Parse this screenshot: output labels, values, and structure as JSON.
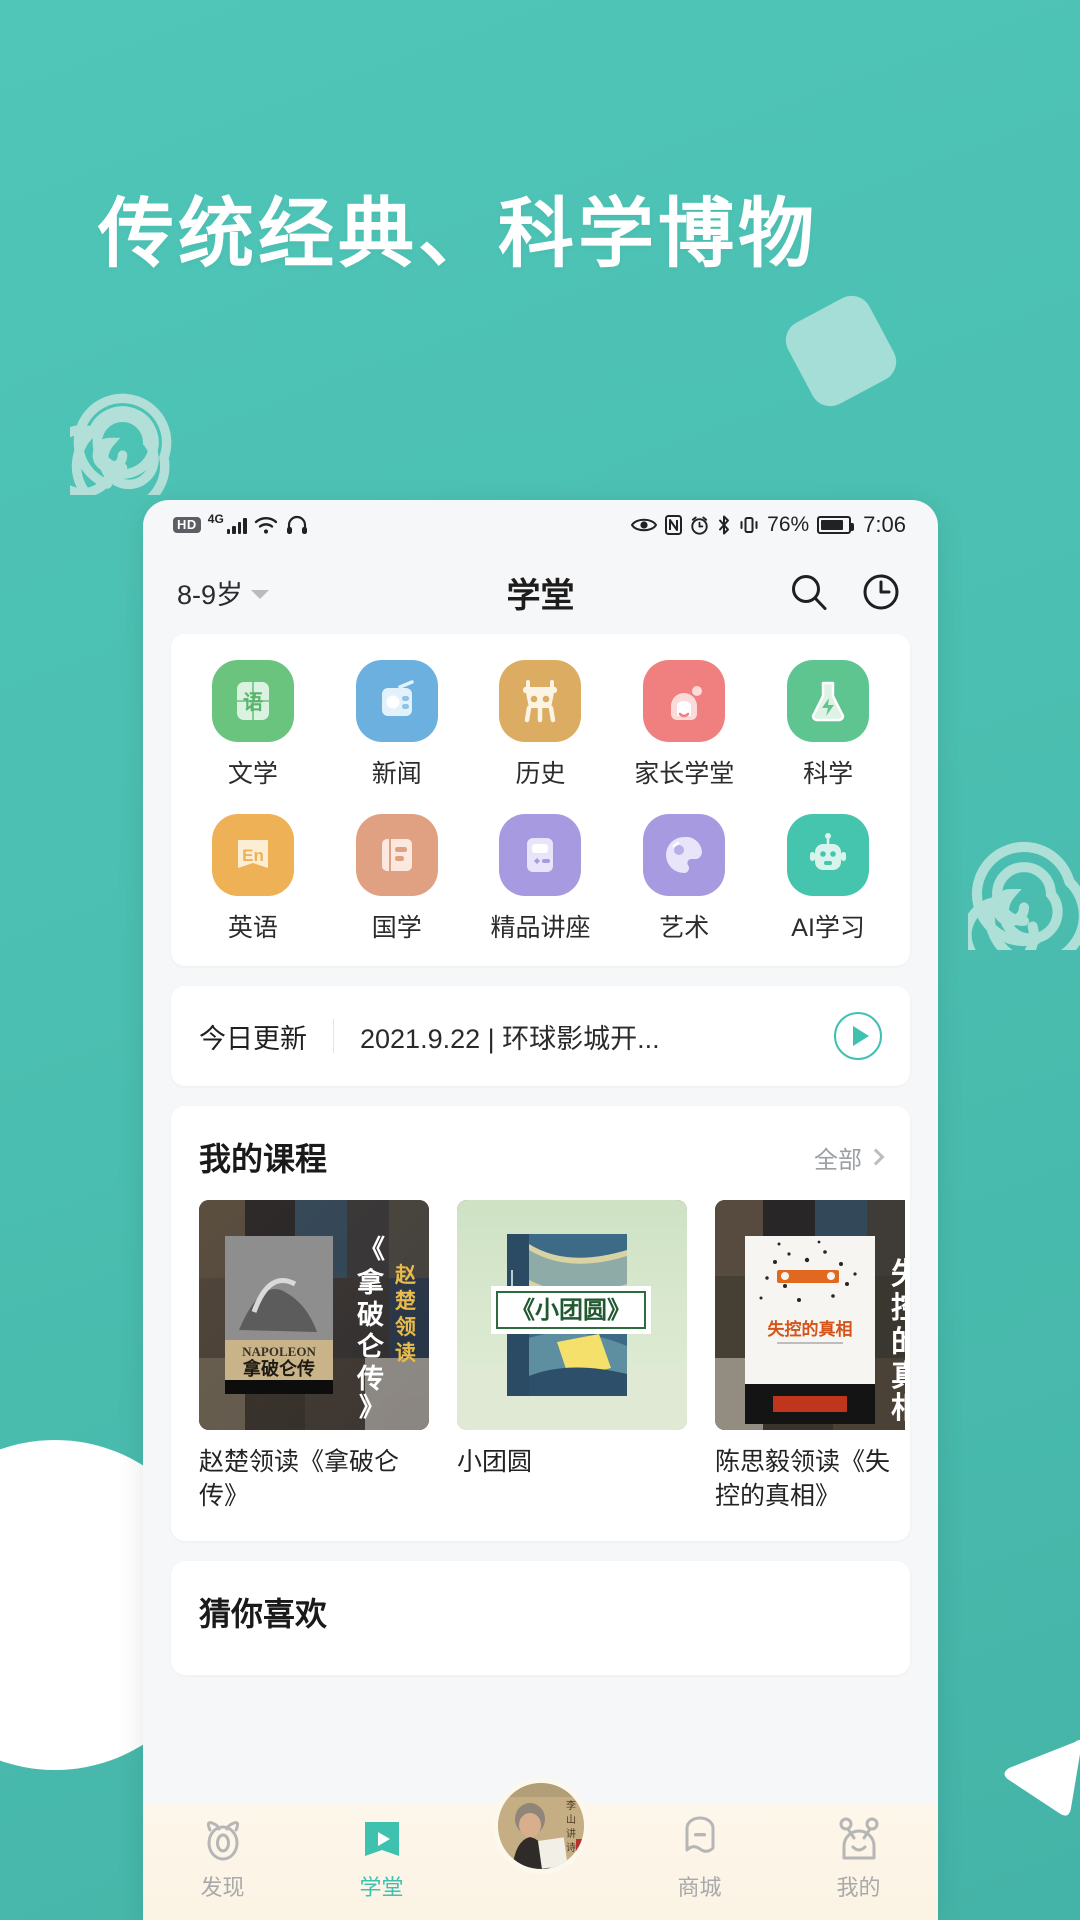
{
  "promo": {
    "title": "传统经典、科学博物",
    "bg_color": "#4cc1b4",
    "accent_color": "#3fc1b0"
  },
  "statusbar": {
    "hd": "HD",
    "network": "4G",
    "icons_left": [
      "hd-badge",
      "4g-label",
      "signal-bars-icon",
      "wifi-icon",
      "headphones-icon"
    ],
    "icons_right": [
      "eye-comfort-icon",
      "nfc-icon",
      "alarm-icon",
      "bluetooth-icon",
      "vibrate-icon"
    ],
    "battery_percent": "76%",
    "time": "7:06"
  },
  "header": {
    "age_label": "8-9岁",
    "title": "学堂",
    "search_icon": "search-icon",
    "history_icon": "clock-history-icon"
  },
  "categories": [
    {
      "label": "文学",
      "glyph": "语",
      "bg": "#6ac47e",
      "fg": "#d9f0de"
    },
    {
      "label": "新闻",
      "glyph": "radio",
      "bg": "#6bb0de",
      "fg": "#e2f1fb"
    },
    {
      "label": "历史",
      "glyph": "ding",
      "bg": "#dbac62",
      "fg": "#fbf3e4"
    },
    {
      "label": "家长学堂",
      "glyph": "face",
      "bg": "#f08080",
      "fg": "#fde0e0"
    },
    {
      "label": "科学",
      "glyph": "flask",
      "bg": "#5ec490",
      "fg": "#dff2e6"
    },
    {
      "label": "英语",
      "glyph": "En",
      "bg": "#efb155",
      "fg": "#fbeed5"
    },
    {
      "label": "国学",
      "glyph": "book",
      "bg": "#e0a082",
      "fg": "#fbe8de"
    },
    {
      "label": "精品讲座",
      "glyph": "console",
      "bg": "#a79ae0",
      "fg": "#e5e1f8"
    },
    {
      "label": "艺术",
      "glyph": "palette",
      "bg": "#a79ae0",
      "fg": "#e5e1f8"
    },
    {
      "label": "AI学习",
      "glyph": "robot",
      "bg": "#45c5ae",
      "fg": "#d6f3ec"
    }
  ],
  "today": {
    "tag": "今日更新",
    "text": "2021.9.22 | 环球影城开...",
    "play_icon": "play-circle-icon"
  },
  "my_courses": {
    "title": "我的课程",
    "more_label": "全部",
    "items": [
      {
        "name": "赵楚领读《拿破仑传》",
        "cover_title": "NAPOLEON",
        "cover_cn": "拿破仑传",
        "overlay": "《拿破仑传》",
        "overlay2": "赵楚领读"
      },
      {
        "name": "小团圆",
        "cover_title": "《小团圆》",
        "cover_cn": "",
        "overlay": "",
        "overlay2": ""
      },
      {
        "name": "陈思毅领读《失控的真相》",
        "cover_title": "失控的真相",
        "cover_cn": "",
        "overlay": "《失控的真相》",
        "overlay2": ""
      }
    ]
  },
  "guess": {
    "title": "猜你喜欢"
  },
  "tabbar": {
    "items": [
      {
        "label": "发现",
        "icon": "discover-icon",
        "active": false
      },
      {
        "label": "学堂",
        "icon": "classroom-icon",
        "active": true
      },
      {
        "label": "",
        "icon": "avatar-icon",
        "active": false
      },
      {
        "label": "商城",
        "icon": "shop-icon",
        "active": false
      },
      {
        "label": "我的",
        "icon": "profile-icon",
        "active": false
      }
    ]
  }
}
